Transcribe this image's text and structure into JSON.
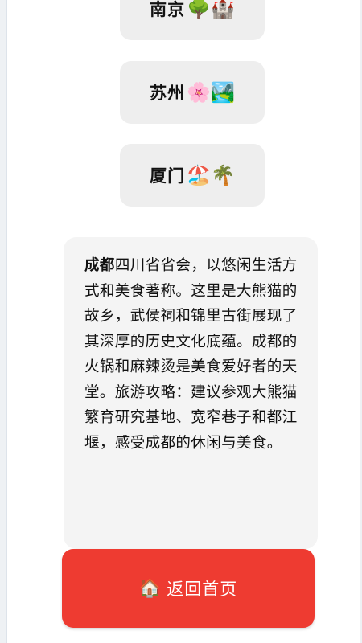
{
  "cities": [
    {
      "name": "南京",
      "emoji": "🌳🏰"
    },
    {
      "name": "苏州",
      "emoji": "🌸🏞️"
    },
    {
      "name": "厦门",
      "emoji": "🏖️🌴"
    }
  ],
  "detail": {
    "city": "成都",
    "description": "四川省省会，以悠闲生活方式和美食著称。这里是大熊猫的故乡，武侯祠和锦里古街展现了其深厚的历史文化底蕴。成都的火锅和麻辣烫是美食爱好者的天堂。旅游攻略：建议参观大熊猫繁育研究基地、宽窄巷子和都江堰，感受成都的休闲与美食。"
  },
  "home_button": {
    "icon": "🏠",
    "label": "返回首页"
  },
  "colors": {
    "home_button": "#ee3b31",
    "city_button": "#eeeeee",
    "card": "#f4f4f4"
  }
}
